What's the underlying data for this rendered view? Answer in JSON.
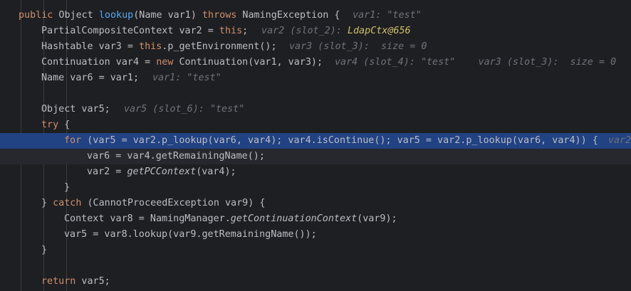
{
  "editor": {
    "lines": [
      {
        "tokens": [
          {
            "t": "public",
            "c": "kw"
          },
          {
            "t": " Object "
          },
          {
            "t": "lookup",
            "c": "fn"
          },
          {
            "t": "(Name var1) "
          },
          {
            "t": "throws",
            "c": "kw"
          },
          {
            "t": " NamingException {"
          }
        ],
        "hint": [
          {
            "t": "var1: "
          },
          {
            "t": "\"test\"",
            "c": "val"
          }
        ]
      },
      {
        "tokens": [
          {
            "t": "PartialCompositeContext var2 = "
          },
          {
            "t": "this",
            "c": "kw"
          },
          {
            "t": ";"
          }
        ],
        "hint": [
          {
            "t": "var2 (slot_2): "
          },
          {
            "t": "LdapCtx@656",
            "c": "obj"
          }
        ]
      },
      {
        "tokens": [
          {
            "t": "Hashtable var3 = "
          },
          {
            "t": "this",
            "c": "kw"
          },
          {
            "t": ".p_getEnvironment();"
          }
        ],
        "hint": [
          {
            "t": "var3 (slot_3):  size = 0"
          }
        ]
      },
      {
        "tokens": [
          {
            "t": "Continuation var4 = "
          },
          {
            "t": "new",
            "c": "kw"
          },
          {
            "t": " Continuation(var1, var3);"
          }
        ],
        "hint": [
          {
            "t": "var4 (slot_4): "
          },
          {
            "t": "\"test\"",
            "c": "val"
          },
          {
            "t": "    var3 (slot_3):  size = 0"
          }
        ]
      },
      {
        "tokens": [
          {
            "t": "Name var6 = var1;"
          }
        ],
        "hint": [
          {
            "t": "var1: "
          },
          {
            "t": "\"test\"",
            "c": "val"
          }
        ]
      },
      {
        "tokens": []
      },
      {
        "tokens": [
          {
            "t": "Object var5;"
          }
        ],
        "hint": [
          {
            "t": "var5 (slot_6): "
          },
          {
            "t": "\"test\"",
            "c": "val"
          }
        ]
      },
      {
        "tokens": [
          {
            "t": "try",
            "c": "kw"
          },
          {
            "t": " {"
          }
        ]
      },
      {
        "tokens": [
          {
            "t": "for",
            "c": "kw"
          },
          {
            "t": " (var5 = var2.p_lookup(var6, var4); var4.isContinue(); var5 = var2.p_lookup(var6, var4)) {"
          }
        ],
        "hint": [
          {
            "t": "var2"
          }
        ]
      },
      {
        "tokens": [
          {
            "t": "var6 = var4.getRemainingName();"
          }
        ]
      },
      {
        "tokens": [
          {
            "t": "var2 = "
          },
          {
            "t": "getPCContext",
            "c": "it"
          },
          {
            "t": "(var4);"
          }
        ]
      },
      {
        "tokens": [
          {
            "t": "}"
          }
        ]
      },
      {
        "tokens": [
          {
            "t": "} "
          },
          {
            "t": "catch",
            "c": "kw"
          },
          {
            "t": " (CannotProceedException var9) {"
          }
        ]
      },
      {
        "tokens": [
          {
            "t": "Context var8 = NamingManager."
          },
          {
            "t": "getContinuationContext",
            "c": "it"
          },
          {
            "t": "(var9);"
          }
        ]
      },
      {
        "tokens": [
          {
            "t": "var5 = var8.lookup(var9.getRemainingName());"
          }
        ]
      },
      {
        "tokens": [
          {
            "t": "}"
          }
        ]
      },
      {
        "tokens": []
      },
      {
        "tokens": [
          {
            "t": "return",
            "c": "kw"
          },
          {
            "t": " var5;"
          }
        ]
      }
    ]
  }
}
